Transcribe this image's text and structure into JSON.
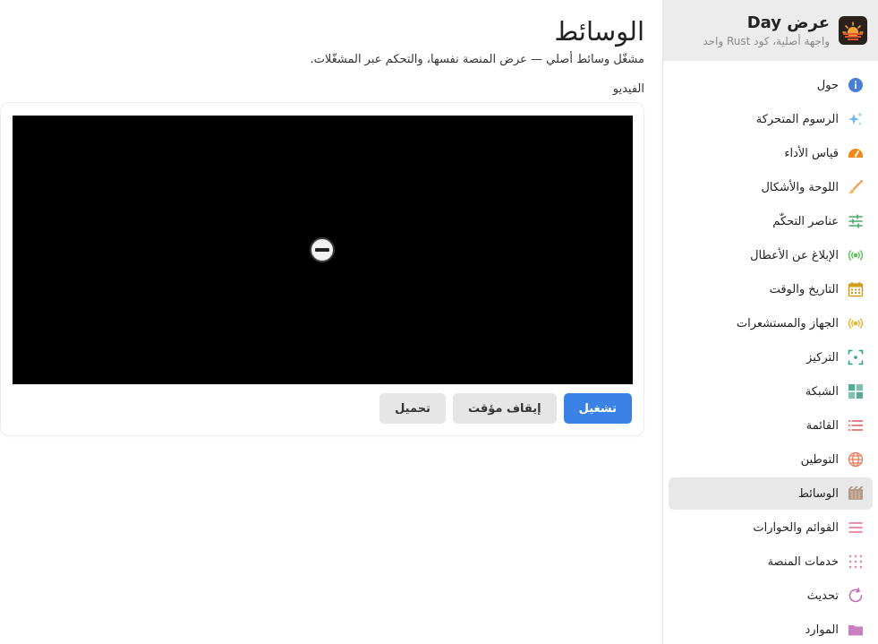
{
  "app": {
    "title": "عرض Day",
    "subtitle": "واجهة أصلية، كود Rust واحد"
  },
  "sidebar": {
    "items": [
      {
        "label": "حول",
        "icon": "info-icon",
        "color": "#4a7fd8"
      },
      {
        "label": "الرسوم المتحركة",
        "icon": "sparkles-icon",
        "color": "#6fb7f0"
      },
      {
        "label": "قياس الأداء",
        "icon": "gauge-icon",
        "color": "#f08a1c"
      },
      {
        "label": "اللوحة والأشكال",
        "icon": "brush-icon",
        "color": "#f5a35c"
      },
      {
        "label": "عناصر التحكّم",
        "icon": "sliders-icon",
        "color": "#4aa86a"
      },
      {
        "label": "الإبلاغ عن الأعطال",
        "icon": "broadcast-icon",
        "color": "#5bbf5b"
      },
      {
        "label": "التاريخ والوقت",
        "icon": "calendar-icon",
        "color": "#d49a1e"
      },
      {
        "label": "الجهاز والمستشعرات",
        "icon": "sensor-icon",
        "color": "#e5b52a"
      },
      {
        "label": "التركيز",
        "icon": "focus-icon",
        "color": "#2fa28c"
      },
      {
        "label": "الشبكة",
        "icon": "grid-icon",
        "color": "#5aa898"
      },
      {
        "label": "القائمة",
        "icon": "list-icon",
        "color": "#e05a5a"
      },
      {
        "label": "التوطين",
        "icon": "globe-icon",
        "color": "#f07a5a"
      },
      {
        "label": "الوسائط",
        "icon": "film-icon",
        "color": "#b59a8a"
      },
      {
        "label": "القوائم والحوارات",
        "icon": "menu-icon",
        "color": "#e56a8a"
      },
      {
        "label": "خدمات المنصة",
        "icon": "dots-grid-icon",
        "color": "#e68aa8"
      },
      {
        "label": "تحديث",
        "icon": "refresh-icon",
        "color": "#c070b8"
      },
      {
        "label": "الموارد",
        "icon": "folder-icon",
        "color": "#c880c0"
      }
    ]
  },
  "main": {
    "title": "الوسائط",
    "description": "مشغّل وسائط أصلي — عرض المنصة نفسها، والتحكم عبر المشغّلات.",
    "section_label": "الفيديو",
    "buttons": {
      "play": "تشغيل",
      "pause": "إيقاف مؤقت",
      "load": "تحميل"
    }
  },
  "colors": {
    "accent": "#3b82e6",
    "active_item_bg": "#e8e8e8",
    "sidebar_header_bg": "#ececec"
  }
}
